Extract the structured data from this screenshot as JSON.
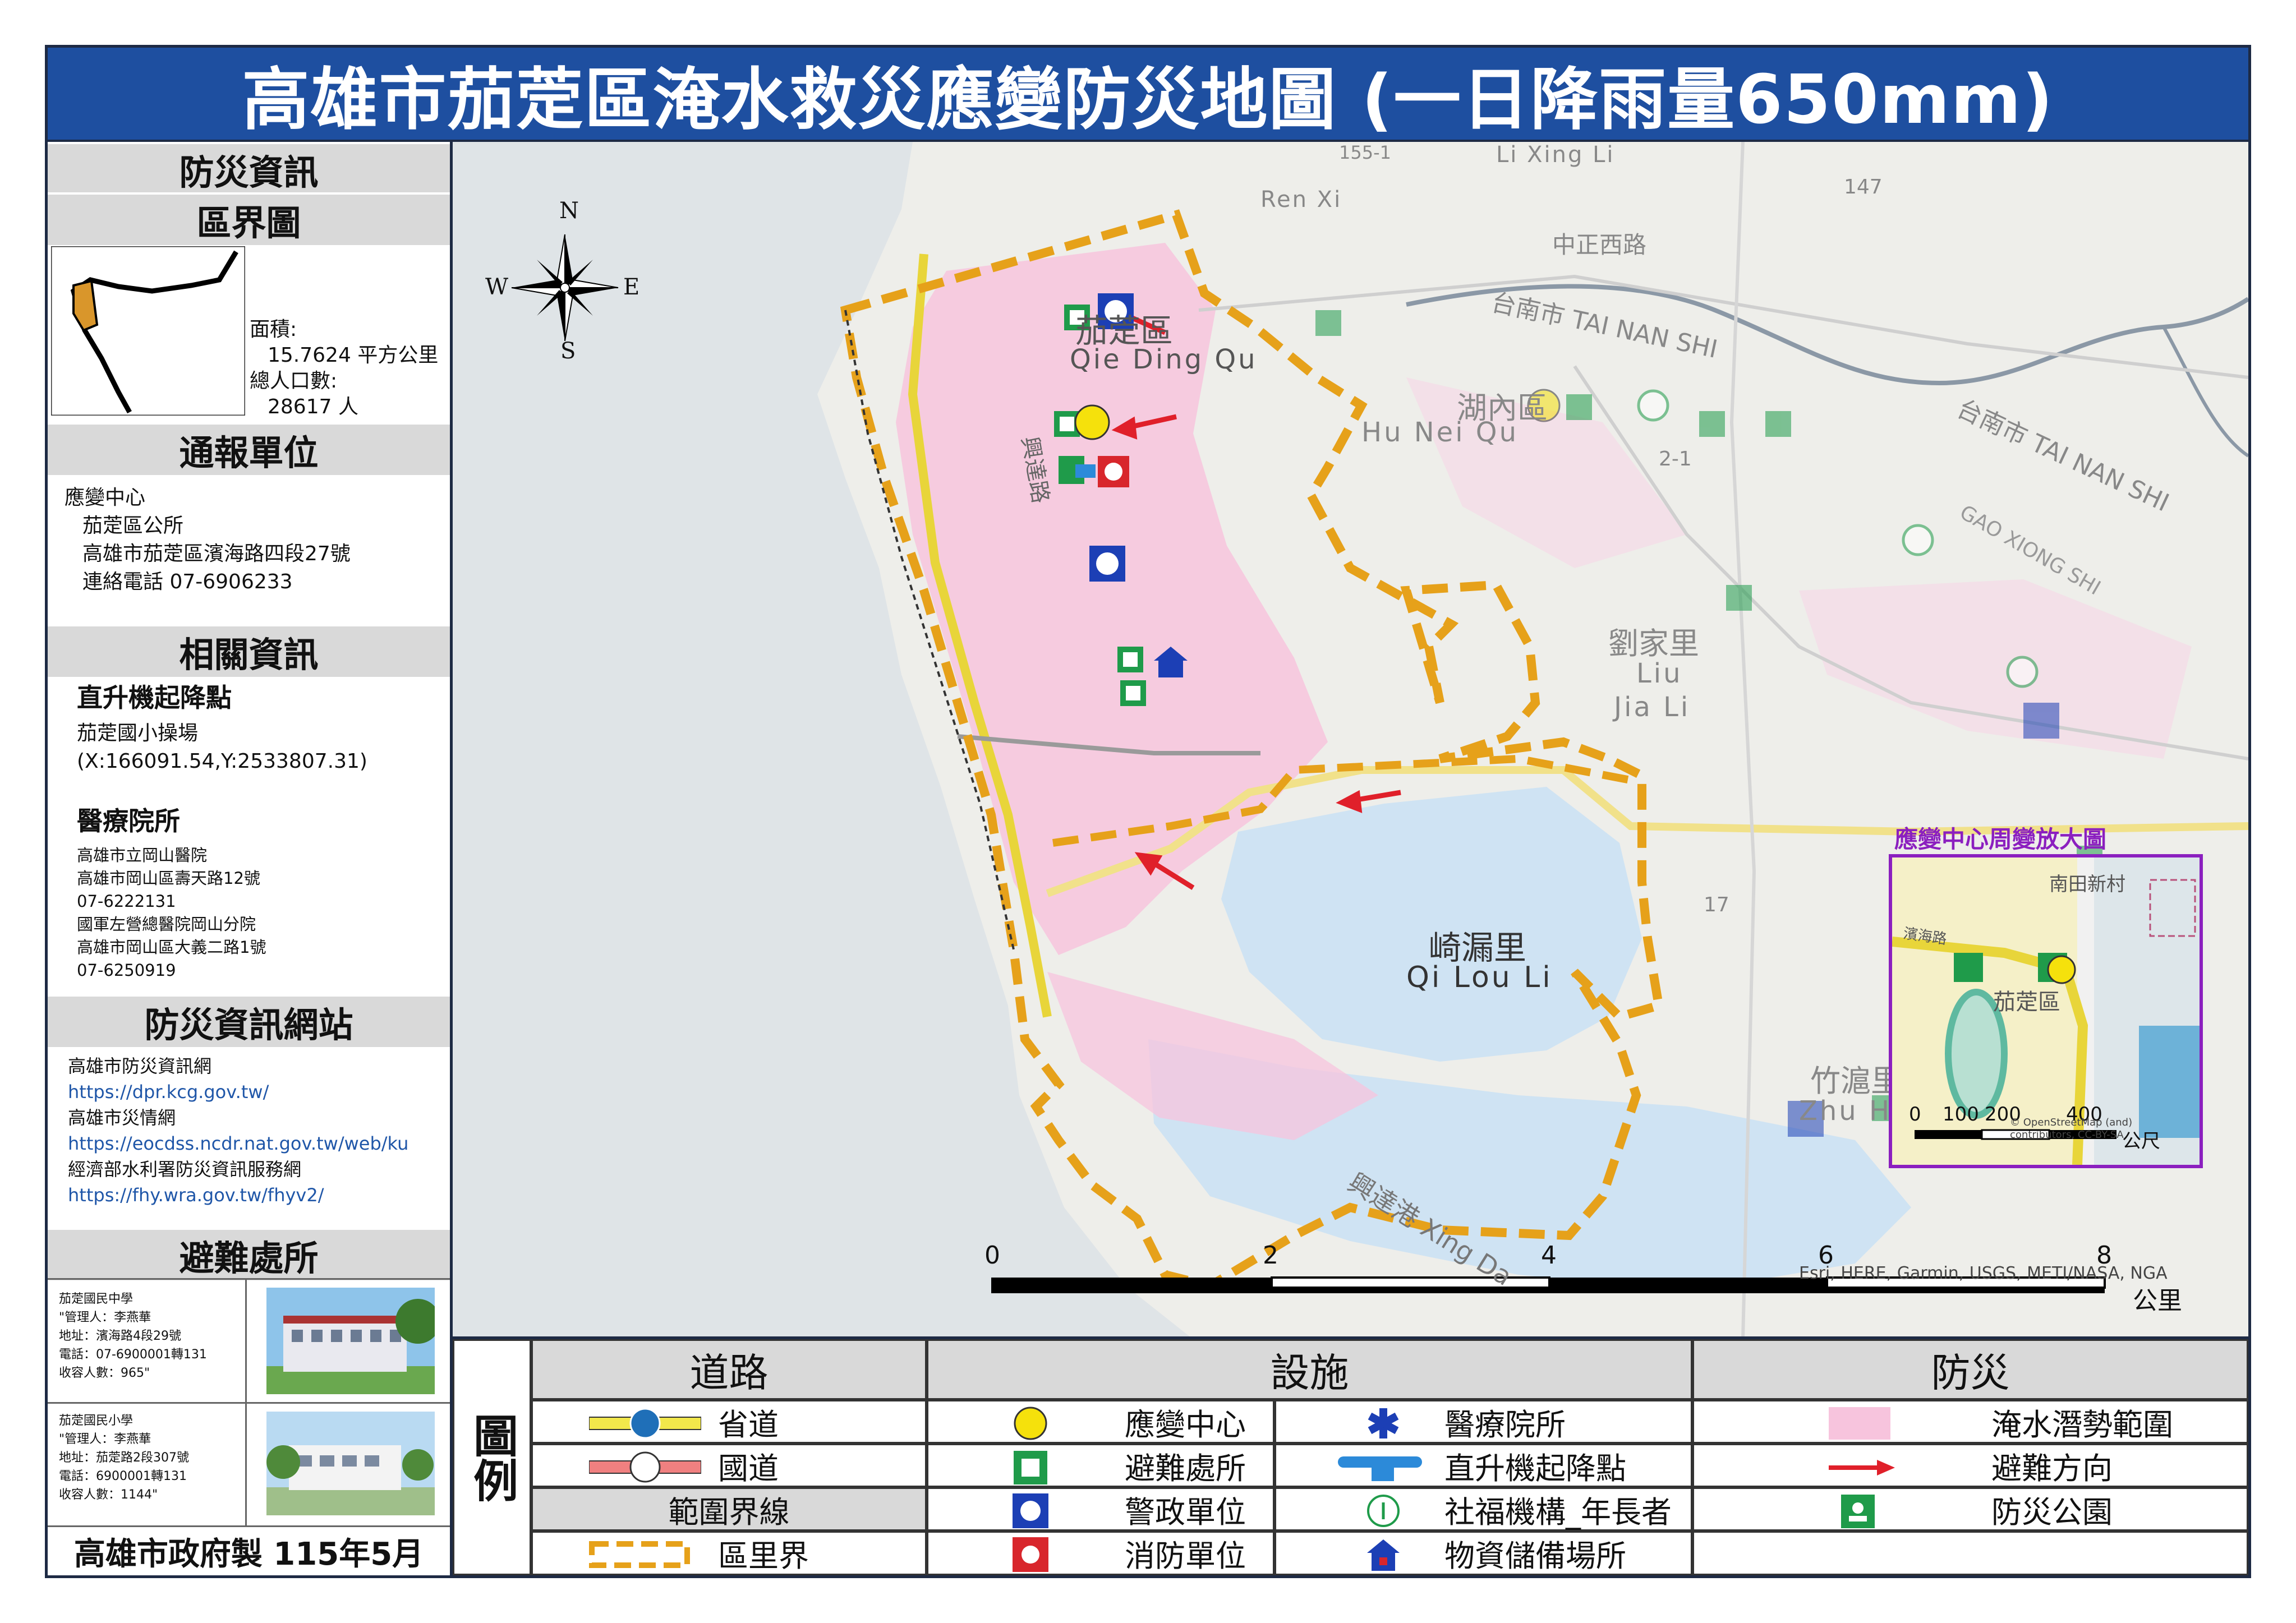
{
  "title": "高雄市茄萣區淹水救災應變防災地圖 (一日降雨量650mm)",
  "sidebar": {
    "heading_info": "防災資訊",
    "heading_district": "區界圖",
    "area_label": "面積:",
    "area_value": "15.7624 平方公里",
    "population_label": "總人口數:",
    "population_value": "28617 人",
    "heading_report": "通報單位",
    "report_lines": [
      "應變中心",
      "茄萣區公所",
      "高雄市茄萣區濱海路四段27號",
      "連絡電話 07-6906233"
    ],
    "heading_related": "相關資訊",
    "heli_title": "直升機起降點",
    "heli_name": "茄萣國小操場",
    "heli_coord": "(X:166091.54,Y:2533807.31)",
    "medical_title": "醫療院所",
    "medical_lines": [
      "高雄市立岡山醫院",
      "高雄市岡山區壽天路12號",
      "07-6222131",
      "國軍左營總醫院岡山分院",
      "高雄市岡山區大義二路1號",
      "07-6250919"
    ],
    "heading_websites": "防災資訊網站",
    "web_lines": [
      "高雄市防災資訊網",
      "https://dpr.kcg.gov.tw/",
      "高雄市災情網",
      "https://eocdss.ncdr.nat.gov.tw/web/ku",
      "經濟部水利署防災資訊服務網",
      "https://fhy.wra.gov.tw/fhyv2/"
    ],
    "heading_shelter": "避難處所",
    "shelters": [
      {
        "lines": [
          "茄萣國民中學",
          "\"管理人：李燕華",
          "地址：濱海路4段29號",
          "電話：07-6900001轉131",
          "收容人數：965\""
        ]
      },
      {
        "lines": [
          "茄萣國民小學",
          "\"管理人：李燕華",
          "地址：茄萣路2段307號",
          "電話：6900001轉131",
          "收容人數：1144\""
        ]
      }
    ],
    "footer": "高雄市政府製 115年5月"
  },
  "map": {
    "compass": {
      "n": "N",
      "s": "S",
      "e": "E",
      "w": "W"
    },
    "labels": {
      "qieding_cn": "茄萣區",
      "qieding_en": "Qie Ding Qu",
      "hunei_cn": "湖內區",
      "hunei_en": "Hu Nei Qu",
      "liujia_cn": "劉家里",
      "liujia_en1": "Liu",
      "liujia_en2": "Jia Li",
      "qilou_cn": "崎漏里",
      "qilou_en": "Qi Lou Li",
      "zhuhu_cn": "竹滬里",
      "zhuhu_en": "Zhu Hu Li",
      "xingda": "興達港 Xing Da",
      "tainan": "台南市 TAI NAN SHI",
      "tainan2": "台南市 TAI NAN SHI",
      "zhongzheng": "中正西路",
      "xingda_rd": "興達路",
      "lixing": "Li Xing Li",
      "renxi": "Ren Xi",
      "gaoxiong": "GAO XIONG SHI",
      "hwy147": "147",
      "hwy17": "17",
      "hwy2_1": "2-1",
      "hwy155": "155-1"
    },
    "scale": {
      "ticks": [
        "0",
        "2",
        "4",
        "6",
        "8"
      ],
      "unit": "公里"
    },
    "attribution": "Esri, HERE, Garmin, USGS, METI/NASA, NGA",
    "inset": {
      "title": "應變中心周變放大圖",
      "label_nantian": "南田新村",
      "label_road": "濱海路",
      "label_qieding": "茄萣區",
      "scale_ticks": [
        "0",
        "100",
        "200",
        "400"
      ],
      "scale_unit": "公尺",
      "attribution": "© OpenStreetMap (and) contributors, CC-BY-SA"
    }
  },
  "legend": {
    "label": "圖例",
    "roads_head": "道路",
    "facilities_head": "設施",
    "prevention_head": "防災",
    "road_items": [
      "省道",
      "國道",
      "範圍界線",
      "區里界"
    ],
    "facility_left": [
      "應變中心",
      "避難處所",
      "警政單位",
      "消防單位"
    ],
    "facility_right": [
      "醫療院所",
      "直升機起降點",
      "社福機構_年長者",
      "物資儲備場所"
    ],
    "prevention_items": [
      "淹水潛勢範圍",
      "避難方向",
      "防災公園"
    ]
  },
  "colors": {
    "title_bg": "#1e4fa0",
    "boundary": "#e6a11a",
    "flood": "#f7c4dd",
    "arrow": "#e0202a",
    "shelter_green": "#1f9b4a",
    "police_blue": "#1c3fb5",
    "fire_red": "#d8262c",
    "eoc_yellow": "#f5e10c",
    "inset_border": "#8b1fbf"
  }
}
